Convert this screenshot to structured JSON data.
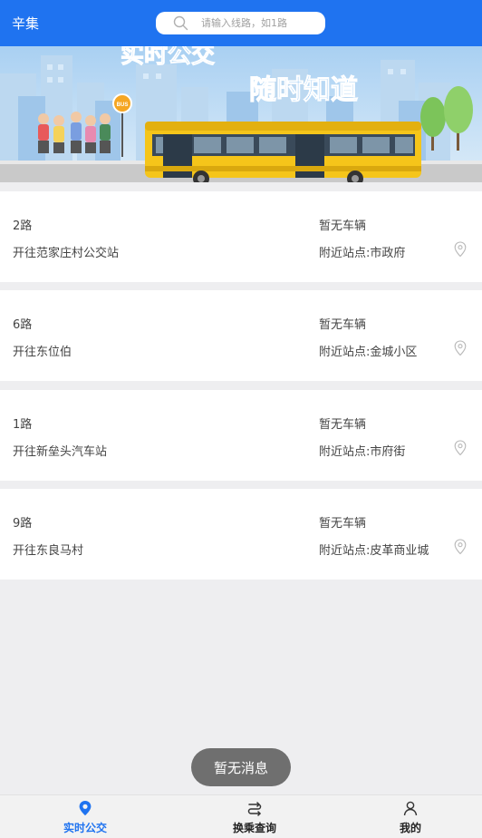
{
  "header": {
    "city": "辛集",
    "search_placeholder": "请输入线路，如1路"
  },
  "banner": {
    "headline_1": "实时公交",
    "headline_2": "随时知道",
    "bus_stop_sign": "BUS"
  },
  "routes": [
    {
      "name": "2路",
      "direction": "开往范家庄村公交站",
      "status": "暂无车辆",
      "nearby_label": "附近站点:",
      "nearby_stop": "市政府"
    },
    {
      "name": "6路",
      "direction": "开往东位伯",
      "status": "暂无车辆",
      "nearby_label": "附近站点:",
      "nearby_stop": "金城小区"
    },
    {
      "name": "1路",
      "direction": "开往新垒头汽车站",
      "status": "暂无车辆",
      "nearby_label": "附近站点:",
      "nearby_stop": "市府街"
    },
    {
      "name": "9路",
      "direction": "开往东良马村",
      "status": "暂无车辆",
      "nearby_label": "附近站点:",
      "nearby_stop": "皮革商业城"
    }
  ],
  "toast": "暂无消息",
  "bottom_nav": [
    {
      "label": "实时公交",
      "icon": "location-pin-icon",
      "active": true
    },
    {
      "label": "换乘查询",
      "icon": "transfer-icon",
      "active": false
    },
    {
      "label": "我的",
      "icon": "user-icon",
      "active": false
    }
  ],
  "colors": {
    "primary": "#1f73f0",
    "background": "#eeeef0",
    "card": "#ffffff",
    "toast_bg": "#6f6f6f",
    "bus_yellow": "#f5c51a"
  }
}
